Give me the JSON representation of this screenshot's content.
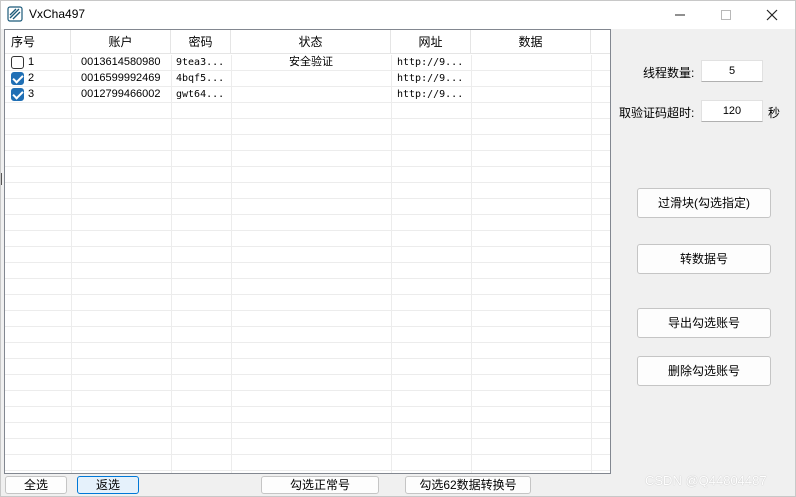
{
  "window": {
    "title": "VxCha497"
  },
  "grid": {
    "columns": [
      "序号",
      "账户",
      "密码",
      "状态",
      "网址",
      "数据"
    ],
    "rows": [
      {
        "checked": false,
        "index": "1",
        "account": "0013614580980",
        "password": "9tea3...",
        "status": "安全验证",
        "url": "http://9...",
        "data": ""
      },
      {
        "checked": true,
        "index": "2",
        "account": "0016599992469",
        "password": "4bqf5...",
        "status": "",
        "url": "http://9...",
        "data": ""
      },
      {
        "checked": true,
        "index": "3",
        "account": "0012799466002",
        "password": "gwt64...",
        "status": "",
        "url": "http://9...",
        "data": ""
      }
    ]
  },
  "settings": {
    "threads_label": "线程数量:",
    "threads_value": "5",
    "timeout_label": "取验证码超时:",
    "timeout_value": "120",
    "timeout_unit": "秒"
  },
  "actions": {
    "slider_button": "过滑块(勾选指定)",
    "convert_button": "转数据号",
    "export_button": "导出勾选账号",
    "delete_button": "删除勾选账号"
  },
  "bottom": {
    "select_all": "全选",
    "invert": "返选",
    "select_normal": "勾选正常号",
    "select_convert": "勾选62数据转换号"
  },
  "watermark": "CSDN @Q44804487",
  "colors": {
    "accent": "#1f6fb5",
    "focus_border": "#0078d7"
  }
}
